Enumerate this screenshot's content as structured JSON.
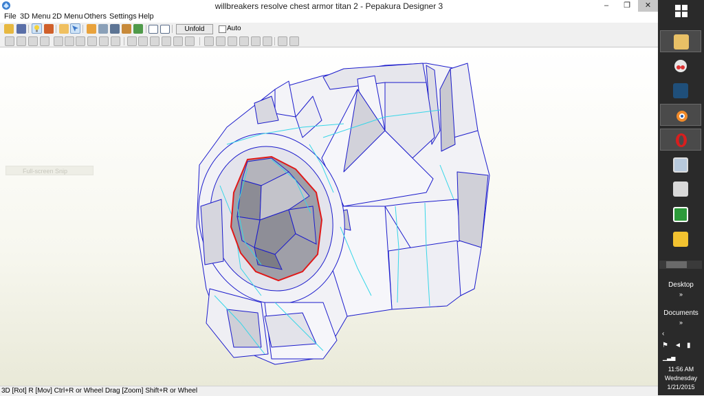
{
  "window": {
    "title": "willbreakers resolve chest armor titan 2 - Pepakura Designer 3",
    "minimize_glyph": "–",
    "restore_glyph": "❐",
    "close_glyph": "✕"
  },
  "menu": {
    "items": [
      "File",
      "3D Menu",
      "2D Menu",
      "Others",
      "Settings",
      "Help"
    ]
  },
  "toolbar": {
    "unfold_label": "Unfold",
    "auto_label": "Auto",
    "auto_checked": false,
    "icons_row1": [
      "open-icon",
      "save-icon",
      "lightbulb-icon",
      "cube-icon",
      "texture-icon",
      "select-icon",
      "pencil-icon",
      "cylinder-icon",
      "anchor-icon",
      "print-icon",
      "tab-icon",
      "window-left-icon",
      "window-right-icon"
    ],
    "icons_row2": [
      "edit-icon",
      "join-icon",
      "fold-icon",
      "rotate-icon",
      "split-icon",
      "tab-flap-icon",
      "move-part-icon",
      "rotate-part-icon",
      "undo-icon",
      "grid-icon",
      "check-icon",
      "layout-icon",
      "align-icon",
      "distribute-icon",
      "snap-icon",
      "zoom-icon"
    ]
  },
  "viewport": {
    "ghost_text": "Full-screen Snip",
    "model_colors": {
      "face": "#f4f4f8",
      "shade": "#c6c6cc",
      "dark": "#9a9aa2",
      "edge": "#1a1acc",
      "fold": "#35d6e8",
      "cut": "#e01818"
    }
  },
  "status": {
    "text": "3D [Rot] R [Mov] Ctrl+R or Wheel Drag [Zoom] Shift+R or Wheel"
  },
  "taskbar": {
    "apps": [
      "start-icon",
      "file-explorer-icon",
      "snipping-tool-icon",
      "app-blue-face-icon",
      "blender-icon",
      "opera-icon",
      "monitor-icon",
      "printer-icon",
      "green-app-icon",
      "scissors-app-icon"
    ],
    "desktop_label": "Desktop",
    "documents_label": "Documents",
    "time": "11:56 AM",
    "day": "Wednesday",
    "date": "1/21/2015"
  }
}
